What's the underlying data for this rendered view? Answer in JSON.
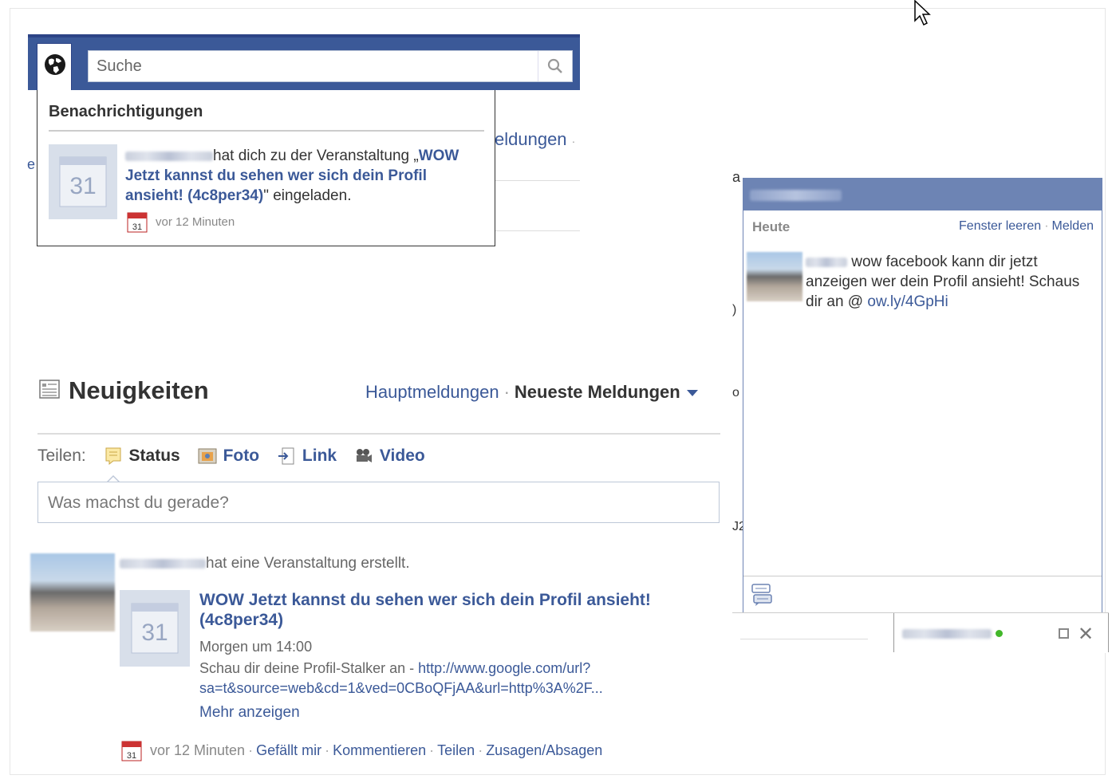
{
  "search": {
    "placeholder": "Suche"
  },
  "notifications": {
    "header": "Benachrichtigungen",
    "item": {
      "text_pre": "hat dich zu der Veranstaltung „",
      "event_name": "WOW Jetzt kannst du sehen wer sich dein Profil ansieht! (4c8per34)",
      "text_post": "\" eingeladen.",
      "time": "vor 12 Minuten",
      "calendar_number": "31",
      "mini_calendar_number": "31"
    }
  },
  "background_fragments": {
    "meldungen": "eldungen",
    "dot": "·",
    "left_char": "e"
  },
  "news_feed": {
    "title": "Neuigkeiten",
    "tab_top": "Hauptmeldungen",
    "tab_recent": "Neueste Meldungen",
    "separator": "·"
  },
  "share": {
    "label": "Teilen:",
    "items": [
      "Status",
      "Foto",
      "Link",
      "Video"
    ],
    "placeholder": "Was machst du gerade?"
  },
  "story": {
    "action": "hat eine Veranstaltung erstellt.",
    "calendar_number": "31",
    "title": "WOW Jetzt kannst du sehen wer sich dein Profil ansieht! (4c8per34)",
    "when": "Morgen um 14:00",
    "desc_prefix": "Schau dir deine Profil-Stalker an - ",
    "desc_link": "http://www.google.com/url?sa=t&source=web&cd=1&ved=0CBoQFjAA&url=http%3A%2F...",
    "more": "Mehr anzeigen",
    "time": "vor 12 Minuten",
    "actions": [
      "Gefällt mir",
      "Kommentieren",
      "Teilen",
      "Zusagen/Absagen"
    ]
  },
  "chat": {
    "behind_text": "a",
    "behind_side": [
      ")",
      "o",
      "J2"
    ],
    "day": "Heute",
    "clear": "Fenster leeren",
    "report": "Melden",
    "message_text": "wow facebook kann dir jetzt anzeigen wer dein Profil ansieht! Schaus dir an @ ",
    "message_link": "ow.ly/4GpHi"
  },
  "colors": {
    "brand_blue": "#3b5998",
    "chat_title": "#6d84b4",
    "online": "#42b72a"
  },
  "icons": [
    "globe-icon",
    "magnifier-icon",
    "calendar-icon",
    "news-feed-icon",
    "status-icon",
    "photo-icon",
    "link-icon",
    "video-icon",
    "chat-compose-icon",
    "maximize-icon",
    "close-icon",
    "mouse-cursor"
  ]
}
